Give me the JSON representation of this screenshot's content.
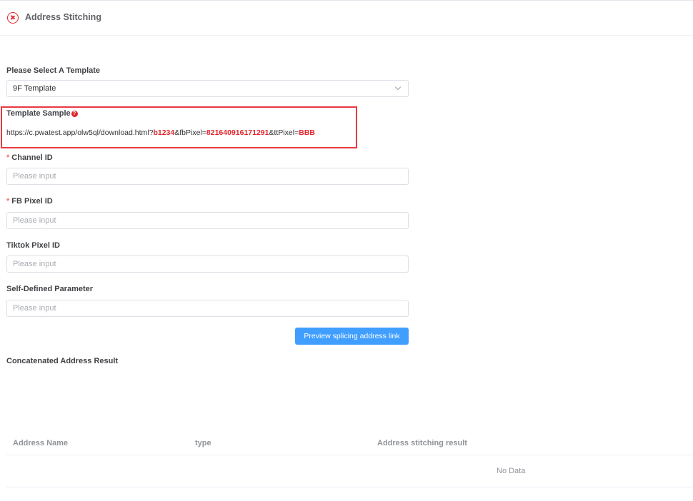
{
  "header": {
    "title": "Address Stitching",
    "close_icon": "close-circle-icon"
  },
  "template_select": {
    "label": "Please Select A Template",
    "value": "9F Template"
  },
  "template_sample": {
    "label": "Template Sample",
    "help_icon": "question-circle-icon",
    "url_parts": {
      "prefix": "https://c.pwatest.app/olw5ql/download.html?",
      "channel": "b1234",
      "fb_key": "&fbPixel=",
      "fb_value": "821640916171291",
      "tt_key": "&ttPixel=",
      "tt_value": "BBB"
    }
  },
  "fields": {
    "channel_id": {
      "required_mark": "*",
      "label": "Channel ID",
      "placeholder": "Please input",
      "value": ""
    },
    "fb_pixel_id": {
      "required_mark": "*",
      "label": "FB Pixel ID",
      "placeholder": "Please input",
      "value": ""
    },
    "tiktok_pixel_id": {
      "label": "Tiktok Pixel ID",
      "placeholder": "Please input",
      "value": ""
    },
    "self_defined": {
      "label": "Self-Defined Parameter",
      "placeholder": "Please input",
      "value": ""
    }
  },
  "preview_button": {
    "label": "Preview splicing address link"
  },
  "result": {
    "title": "Concatenated Address Result",
    "columns": [
      "Address Name",
      "type",
      "Address stitching result"
    ],
    "rows": [],
    "empty_text": "No Data"
  },
  "colors": {
    "accent": "#409eff",
    "highlight": "#e0262d",
    "required": "#f56c6c"
  }
}
